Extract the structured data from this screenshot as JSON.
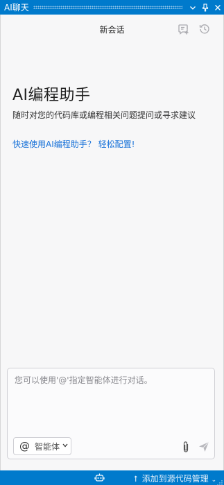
{
  "titlebar": {
    "title": "AI聊天",
    "menu_glyph": "⌄",
    "pin_glyph": "⊥",
    "close_glyph": "✕"
  },
  "header": {
    "title": "新会话",
    "icons": [
      "new-chat-icon",
      "history-icon"
    ]
  },
  "welcome": {
    "title": "AI编程助手",
    "subtitle": "随时对您的代码库或编程相关问题提问或寻求建议",
    "link": "快速使用AI编程助手？ 轻松配置!"
  },
  "input": {
    "placeholder": "您可以使用'@'指定智能体进行对话。",
    "value": "",
    "agent_symbol": "@",
    "agent_label": "智能体",
    "agent_caret": "⌄"
  },
  "statusbar": {
    "source_control_label": "添加到源代码管理",
    "source_caret": "⌄",
    "arrow_glyph": "⭡"
  },
  "colors": {
    "accent": "#007acc",
    "link": "#1a73d9",
    "background": "#f7f7f8"
  }
}
